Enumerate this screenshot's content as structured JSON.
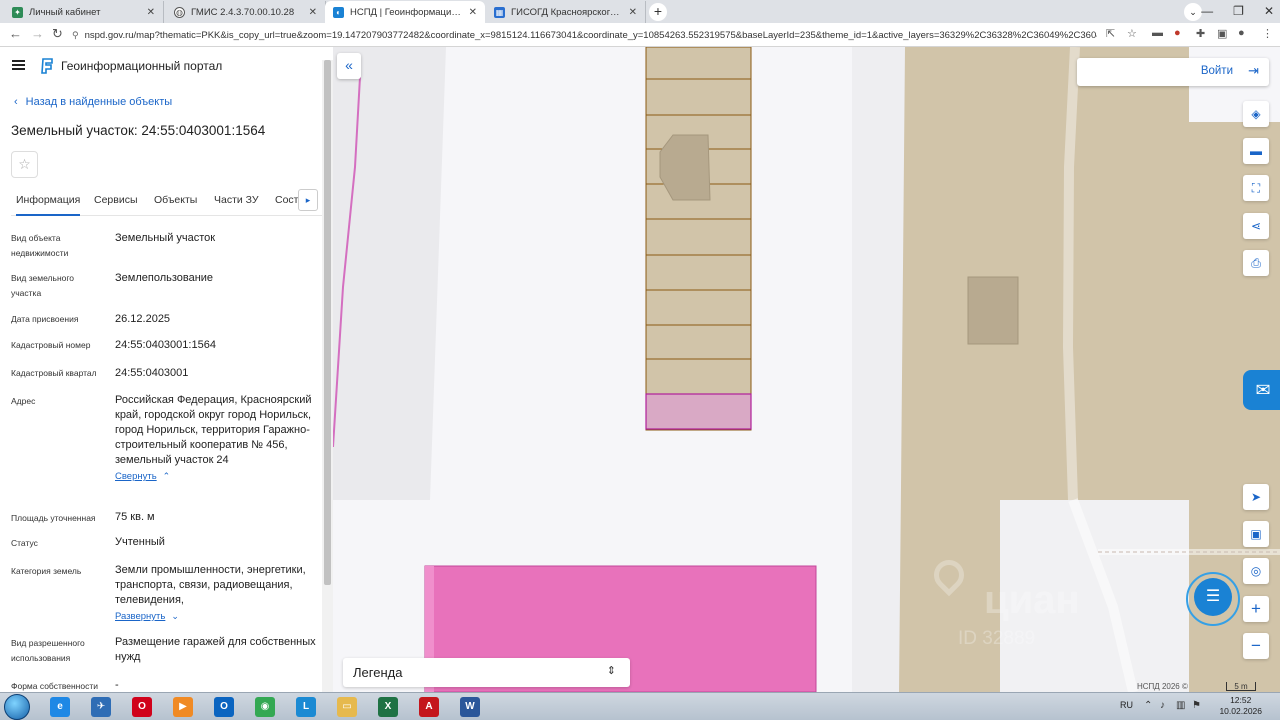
{
  "browser": {
    "tabs": [
      {
        "title": "Личный кабинет",
        "favicon_color": "#2e8b57",
        "active": false
      },
      {
        "title": "ГМИС 2.4.3.70.00.10.28",
        "favicon_color": "#555555",
        "active": false
      },
      {
        "title": "НСПД | Геоинформационный п",
        "favicon_color": "#1a82d4",
        "active": true
      },
      {
        "title": "ГИСОГД Красноярского края",
        "favicon_color": "#2a6fd0",
        "active": false
      }
    ],
    "url": "nspd.gov.ru/map?thematic=PKK&is_copy_url=true&zoom=19.147207903772482&coordinate_x=9815124.116673041&coordinate_y=10854263.552319575&baseLayerId=235&theme_id=1&active_layers=36329%2C36328%2C36049%2C36048..."
  },
  "portal": {
    "name": "Геоинформационный портал",
    "back_link": "Назад в найденные объекты",
    "object_title": "Земельный участок: 24:55:0403001:1564",
    "tabs": [
      "Информация",
      "Сервисы",
      "Объекты",
      "Части ЗУ",
      "Соста"
    ],
    "properties": [
      {
        "label": "Вид объекта недвижимости",
        "value": "Земельный участок"
      },
      {
        "label": "Вид земельного участка",
        "value": "Землепользование"
      },
      {
        "label": "Дата присвоения",
        "value": "26.12.2025"
      },
      {
        "label": "Кадастровый номер",
        "value": "24:55:0403001:1564"
      },
      {
        "label": "Кадастровый квартал",
        "value": "24:55:0403001"
      },
      {
        "label": "Адрес",
        "value": "Российская Федерация, Красноярский край, городской округ город Норильск, город Норильск, территория Гаражно-строительный кооператив № 456, земельный участок 24",
        "toggle": "Свернуть",
        "toggle_chevron": "⌃"
      },
      {
        "label": "Площадь уточненная",
        "value": "75 кв. м"
      },
      {
        "label": "Статус",
        "value": "Учтенный"
      },
      {
        "label": "Категория земель",
        "value": "Земли промышленности, энергетики, транспорта, связи, радиовещания, телевидения,",
        "toggle": "Развернуть",
        "toggle_chevron": "⌄"
      },
      {
        "label": "Вид разрешенного использования",
        "value": "Размещение гаражей для собственных нужд"
      },
      {
        "label": "Форма собственности",
        "value": "-"
      }
    ]
  },
  "map": {
    "login_label": "Войти",
    "legend_label": "Легенда",
    "copyright": "НСПД 2026 ©",
    "scale_label": "5 m",
    "watermark_brand": "циан",
    "watermark_id": "ID 32889",
    "tools": [
      "layers-icon",
      "ruler-icon",
      "area-select-icon",
      "share-icon",
      "print-icon"
    ],
    "tools_lower": [
      "locate-icon",
      "minimap-icon",
      "geo-search-icon"
    ],
    "colors": {
      "parcel_fill": "#d1c4a9",
      "parcel_border": "#8b5a14",
      "selected": "#d9a9c5",
      "selected_border": "#b0209a",
      "pink": "#e872bb",
      "accent": "#1a65c8"
    }
  },
  "taskbar": {
    "lang": "RU",
    "time": "12:52",
    "date": "10.02.2026",
    "apps": [
      {
        "name": "ie-icon",
        "color": "#1e88e5",
        "glyph": "e"
      },
      {
        "name": "bird-icon",
        "color": "#2f6db5",
        "glyph": "✈"
      },
      {
        "name": "opera-icon",
        "color": "#d0021b",
        "glyph": "O"
      },
      {
        "name": "media-player-icon",
        "color": "#f08a24",
        "glyph": "▶"
      },
      {
        "name": "outlook-icon",
        "color": "#0a64c0",
        "glyph": "O"
      },
      {
        "name": "chrome-icon",
        "color": "#34a853",
        "glyph": "◉"
      },
      {
        "name": "lo-icon",
        "color": "#1b8ad3",
        "glyph": "L"
      },
      {
        "name": "folder-icon",
        "color": "#e6b94e",
        "glyph": "▭"
      },
      {
        "name": "excel-icon",
        "color": "#1f7244",
        "glyph": "X"
      },
      {
        "name": "pdf-icon",
        "color": "#c4161c",
        "glyph": "A"
      },
      {
        "name": "word-icon",
        "color": "#2b579a",
        "glyph": "W"
      }
    ]
  }
}
